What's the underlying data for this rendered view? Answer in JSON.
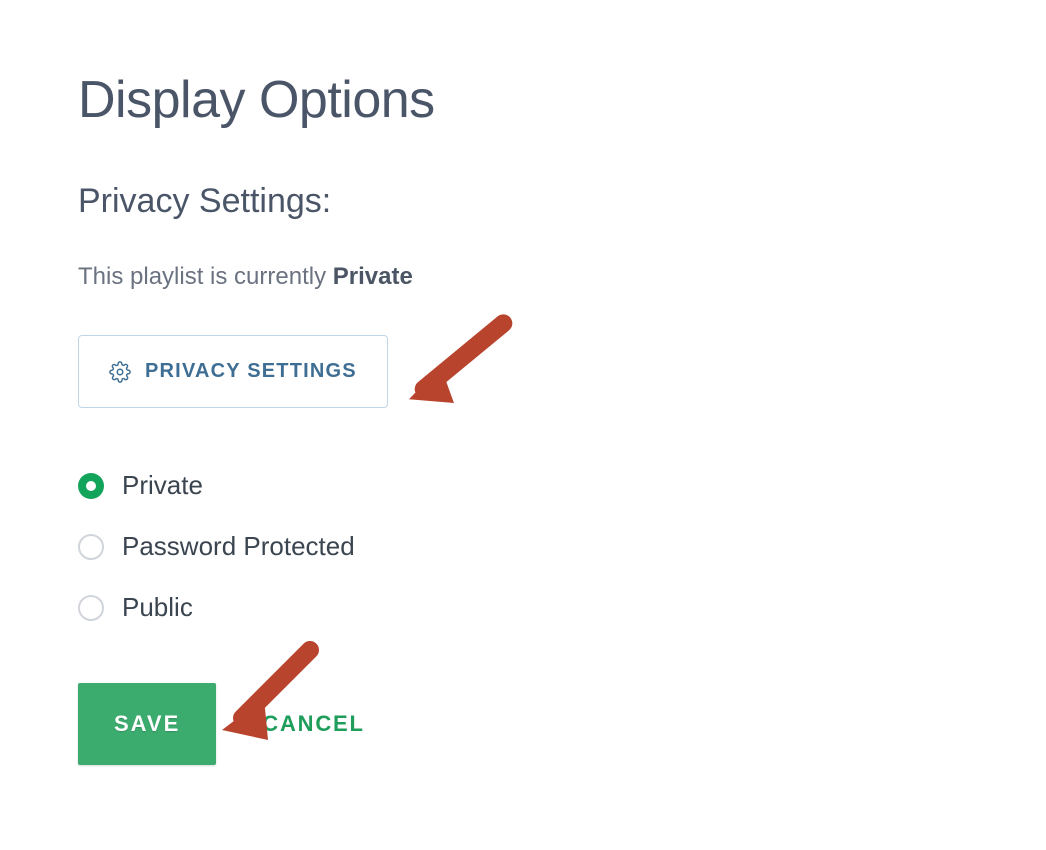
{
  "page": {
    "title": "Display Options"
  },
  "privacy": {
    "section_title": "Privacy Settings:",
    "status_prefix": "This playlist is currently ",
    "status_value": "Private",
    "button_label": "PRIVACY SETTINGS",
    "options": [
      {
        "label": "Private",
        "selected": true
      },
      {
        "label": "Password Protected",
        "selected": false
      },
      {
        "label": "Public",
        "selected": false
      }
    ]
  },
  "actions": {
    "save_label": "SAVE",
    "cancel_label": "CANCEL"
  }
}
